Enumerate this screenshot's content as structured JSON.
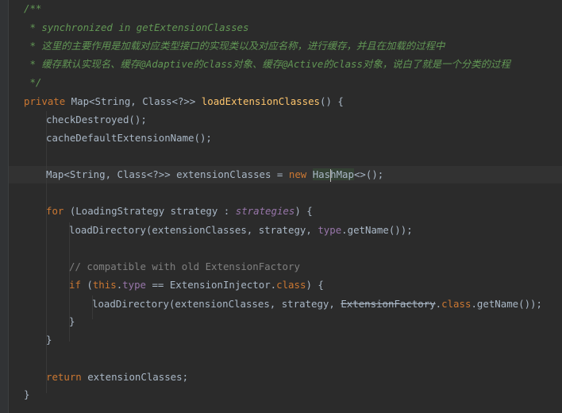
{
  "code": {
    "doc_open": "/**",
    "doc_line1": " * synchronized in getExtensionClasses",
    "doc_line2": " * 这里的主要作用是加载对应类型接口的实现类以及对应名称，进行缓存，并且在加载的过程中",
    "doc_line3": " * 缓存默认实现名、缓存@Adaptive的class对象、缓存@Active的class对象，说白了就是一个分类的过程",
    "doc_close": " */",
    "kw_private": "private",
    "type_map_sig": " Map<String, Class<?>> ",
    "method_name": "loadExtensionClasses",
    "sig_rest": "() {",
    "check_call": "checkDestroyed();",
    "cache_call": "cacheDefaultExtensionName();",
    "map_decl": "Map<String, Class<?>> extensionClasses = ",
    "kw_new": "new",
    "hash_a": "Has",
    "hash_b": "hMap",
    "map_tail": "<>();",
    "kw_for": "for",
    "for_mid": " (LoadingStrategy strategy : ",
    "strategies": "strategies",
    "for_tail": ") {",
    "load1_a": "loadDirectory(extensionClasses, strategy, ",
    "type_field": "type",
    "load1_b": ".getName());",
    "comment_compat": "// compatible with old ExtensionFactory",
    "kw_if": "if",
    "if_a": " (",
    "kw_this": "this",
    "if_b": ".",
    "type_field2": "type",
    "if_c": " == ExtensionInjector.",
    "kw_class": "class",
    "if_d": ") {",
    "load2_a": "loadDirectory(extensionClasses, strategy, ",
    "ext_factory": "ExtensionFactory",
    "load2_b": ".",
    "kw_class2": "class",
    "load2_c": ".getName());",
    "close_if": "}",
    "close_for": "}",
    "kw_return": "return",
    "return_rest": " extensionClasses;",
    "close_method": "}"
  },
  "colors": {
    "background": "#2b2b2b",
    "default_text": "#a9b7c6",
    "keyword": "#cc7832",
    "method": "#ffc66d",
    "field": "#9876aa",
    "doc_comment": "#629755",
    "line_comment": "#808080"
  }
}
